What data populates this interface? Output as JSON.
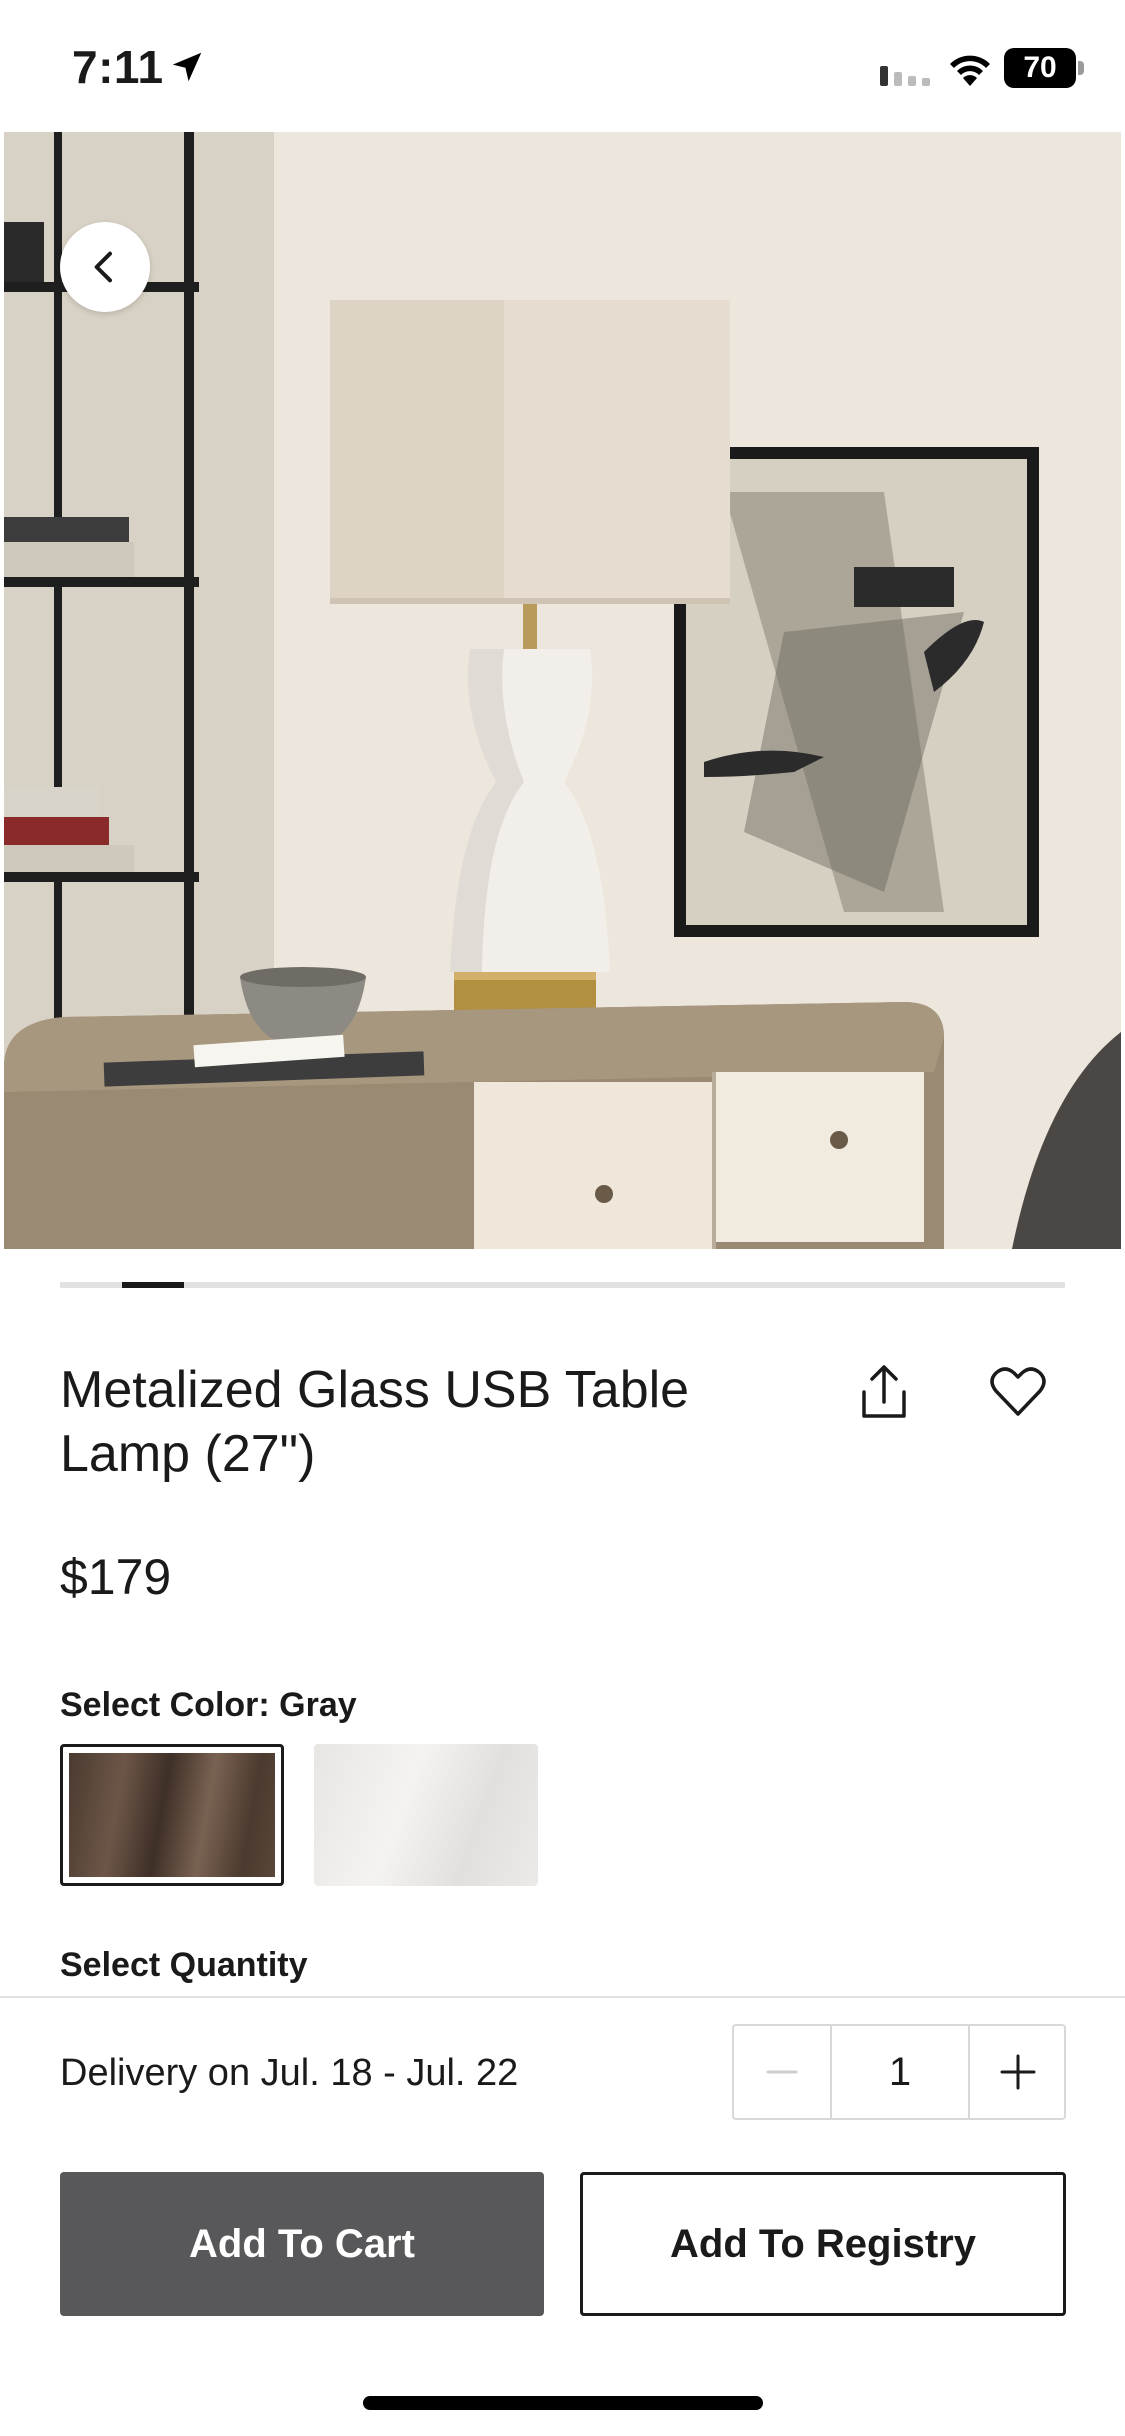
{
  "status_bar": {
    "time": "7:11",
    "battery": "70"
  },
  "product": {
    "title": "Metalized Glass USB Table Lamp (27\")",
    "price": "$179",
    "color_label": "Select Color: Gray",
    "quantity_label": "Select Quantity",
    "swatches": [
      {
        "name": "Gray",
        "selected": true
      },
      {
        "name": "White",
        "selected": false
      }
    ]
  },
  "carousel": {
    "current_index": 1
  },
  "purchase": {
    "delivery": "Delivery on Jul. 18 - Jul. 22",
    "quantity": "1",
    "add_to_cart": "Add To Cart",
    "add_to_registry": "Add To Registry"
  },
  "colors": {
    "primary_button": "#58575a",
    "text": "#1a1a1a",
    "divider": "#e4e4e4"
  },
  "icons": {
    "back": "chevron-left-icon",
    "share": "share-icon",
    "wishlist": "heart-icon",
    "minus": "minus-icon",
    "plus": "plus-icon"
  }
}
